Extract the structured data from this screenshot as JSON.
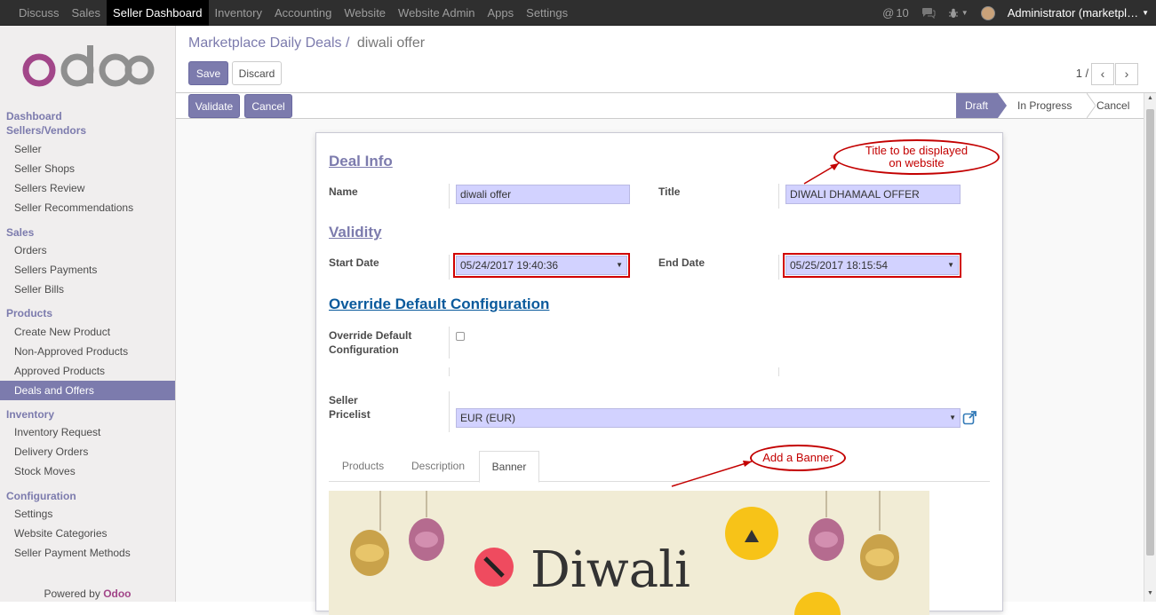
{
  "topnav": {
    "items": [
      "Discuss",
      "Sales",
      "Seller Dashboard",
      "Inventory",
      "Accounting",
      "Website",
      "Website Admin",
      "Apps",
      "Settings"
    ],
    "active_index": 2,
    "mentions": "10",
    "user": "Administrator (marketpl…"
  },
  "sidebar": {
    "logo": "odoo",
    "sections": [
      {
        "title": "Dashboard\nSellers/Vendors",
        "items": [
          "Seller",
          "Seller Shops",
          "Sellers Review",
          "Seller Recommendations"
        ]
      },
      {
        "title": "Sales",
        "items": [
          "Orders",
          "Sellers Payments",
          "Seller Bills"
        ]
      },
      {
        "title": "Products",
        "items": [
          "Create New Product",
          "Non-Approved Products",
          "Approved Products",
          "Deals and Offers"
        ]
      },
      {
        "title": "Inventory",
        "items": [
          "Inventory Request",
          "Delivery Orders",
          "Stock Moves"
        ]
      },
      {
        "title": "Configuration",
        "items": [
          "Settings",
          "Website Categories",
          "Seller Payment Methods"
        ]
      }
    ],
    "sec_dashboard_1": "Dashboard",
    "sec_dashboard_2": "Sellers/Vendors",
    "active_item": "Deals and Offers",
    "powered_prefix": "Powered by",
    "powered_brand": "Odoo"
  },
  "control": {
    "breadcrumb_parent": "Marketplace Daily Deals",
    "breadcrumb_sep": "/",
    "breadcrumb_current": "diwali offer",
    "save_label": "Save",
    "discard_label": "Discard",
    "pager": "1 / 1"
  },
  "statusbar": {
    "validate_label": "Validate",
    "cancel_label": "Cancel",
    "stages": [
      "Draft",
      "In Progress",
      "Cancel"
    ],
    "active_stage": "Draft"
  },
  "form": {
    "deal_info_title": "Deal Info",
    "name_label": "Name",
    "name_value": "diwali offer",
    "title_label": "Title",
    "title_value": "DIWALI DHAMAAL OFFER",
    "validity_title": "Validity",
    "start_label": "Start Date",
    "start_value": "05/24/2017 19:40:36",
    "end_label": "End Date",
    "end_value": "05/25/2017 18:15:54",
    "override_title": "Override Default Configuration",
    "override_label_1": "Override Default",
    "override_label_2": "Configuration",
    "pricelist_label_1": "Seller",
    "pricelist_label_2": "Pricelist",
    "pricelist_value": "EUR (EUR)",
    "tabs": [
      "Products",
      "Description",
      "Banner"
    ],
    "active_tab": "Banner",
    "banner_text": "Diwali"
  },
  "annotations": {
    "title_note_1": "Title to be displayed",
    "title_note_2": "on website",
    "banner_note": "Add a Banner"
  },
  "colors": {
    "brand_purple": "#7c7bad",
    "input_bg": "#d2d2ff",
    "annotation_red": "#c30000",
    "odoo_magenta": "#a24689"
  }
}
